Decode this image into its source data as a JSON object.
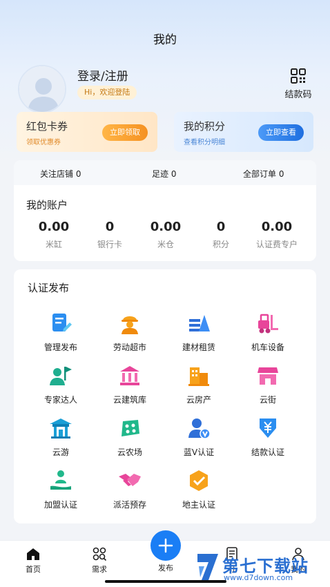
{
  "header": {
    "title": "我的"
  },
  "profile": {
    "login_text": "登录/注册",
    "greeting": "Hi，欢迎登陆",
    "qr_label": "结款码"
  },
  "promos": [
    {
      "title": "红包卡券",
      "sub": "领取优惠券",
      "button": "立即领取"
    },
    {
      "title": "我的积分",
      "sub": "查看积分明细",
      "button": "立即查看"
    }
  ],
  "stats": {
    "follow": "关注店铺 0",
    "footprint": "足迹 0",
    "orders": "全部订单 0"
  },
  "account": {
    "title": "我的账户",
    "items": [
      {
        "value": "0.00",
        "label": "米缸"
      },
      {
        "value": "0",
        "label": "银行卡"
      },
      {
        "value": "0.00",
        "label": "米仓"
      },
      {
        "value": "0",
        "label": "积分"
      },
      {
        "value": "0.00",
        "label": "认证费专户"
      }
    ]
  },
  "cert": {
    "title": "认证发布",
    "items": [
      {
        "label": "管理发布",
        "icon": "manage-publish-icon"
      },
      {
        "label": "劳动超市",
        "icon": "worker-icon"
      },
      {
        "label": "建材租赁",
        "icon": "building-material-icon"
      },
      {
        "label": "机车设备",
        "icon": "forklift-icon"
      },
      {
        "label": "专家达人",
        "icon": "expert-icon"
      },
      {
        "label": "云建筑库",
        "icon": "bank-building-icon"
      },
      {
        "label": "云房产",
        "icon": "real-estate-icon"
      },
      {
        "label": "云街",
        "icon": "shop-icon"
      },
      {
        "label": "云游",
        "icon": "pavilion-icon"
      },
      {
        "label": "云农场",
        "icon": "farm-icon"
      },
      {
        "label": "蓝V认证",
        "icon": "blue-v-icon"
      },
      {
        "label": "结款认证",
        "icon": "yuan-shield-icon"
      },
      {
        "label": "加盟认证",
        "icon": "join-hand-icon"
      },
      {
        "label": "派活预存",
        "icon": "handshake-icon"
      },
      {
        "label": "地主认证",
        "icon": "check-badge-icon"
      }
    ]
  },
  "tabbar": {
    "home": "首页",
    "demand": "需求",
    "publish": "发布",
    "orders": "订",
    "mine": "我的"
  },
  "watermark": {
    "text": "第七下载站",
    "url": "www.d7down.com"
  },
  "colors": {
    "accent": "#1a7ef5",
    "orange": "#f59121"
  }
}
